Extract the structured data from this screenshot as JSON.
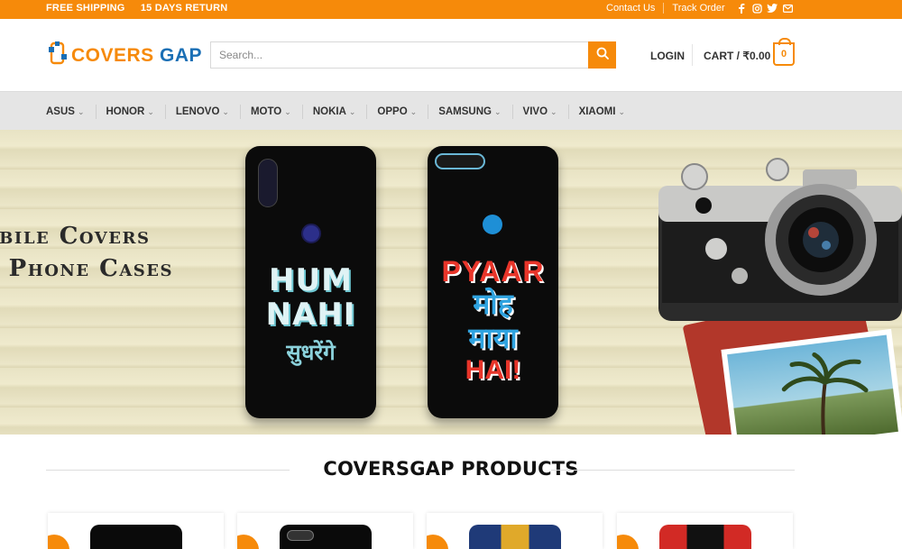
{
  "topbar": {
    "free_shipping": "FREE SHIPPING",
    "days_return": "15 DAYS RETURN",
    "contact": "Contact Us",
    "track": "Track Order",
    "social_icons": [
      "facebook-icon",
      "instagram-icon",
      "twitter-icon",
      "email-icon"
    ]
  },
  "header": {
    "logo_part1": "COVERS",
    "logo_part2": "GAP",
    "search_placeholder": "Search...",
    "login": "LOGIN",
    "cart_label": "CART / ₹0.00",
    "cart_count": "0"
  },
  "nav": {
    "items": [
      "ASUS",
      "HONOR",
      "LENOVO",
      "MOTO",
      "NOKIA",
      "OPPO",
      "SAMSUNG",
      "VIVO",
      "XIAOMI"
    ]
  },
  "banner": {
    "line1": "obile Covers",
    "line2": "d Phone Cases",
    "phone1_art": [
      "HUM",
      "NAHI",
      "सुधरेंगे"
    ],
    "phone2_art": [
      "PYAAR",
      "मोह",
      "माया",
      "HAI!"
    ]
  },
  "section": {
    "title": "COVERSGAP PRODUCTS"
  },
  "colors": {
    "accent": "#f68a0a",
    "brand_blue": "#1a6fb5",
    "nav_bg": "#e5e5e5"
  }
}
